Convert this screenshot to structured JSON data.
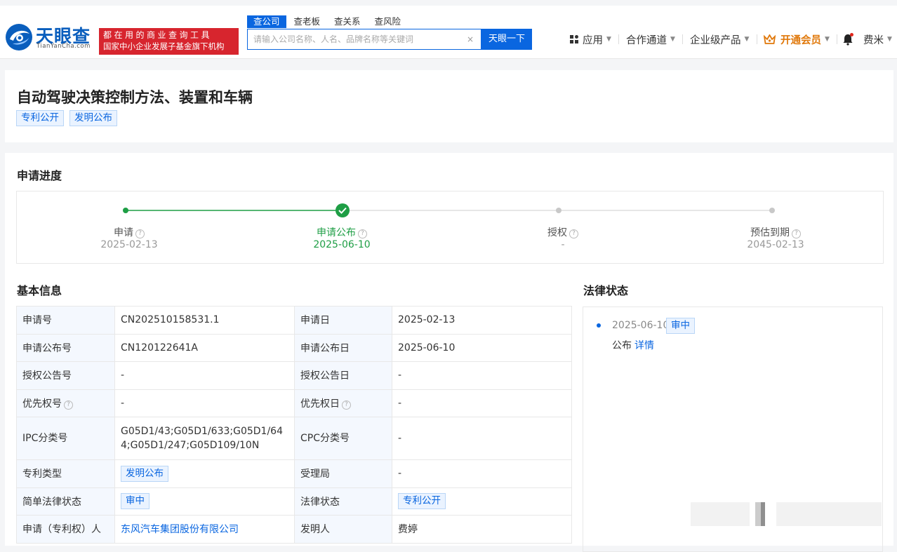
{
  "header": {
    "logo_cn": "天眼查",
    "logo_en": "TianYanCha.com",
    "slogan_line1": "都在用的商业查询工具",
    "slogan_line2": "国家中小企业发展子基金旗下机构",
    "search_tabs": [
      "查公司",
      "查老板",
      "查关系",
      "查风险"
    ],
    "search_placeholder": "请输入公司名称、人名、品牌名称等关键词",
    "search_clear": "×",
    "search_button": "天眼一下",
    "nav": {
      "apps": "应用",
      "partner": "合作通道",
      "enterprise": "企业级产品",
      "vip": "开通会员",
      "user": "费米"
    }
  },
  "patent": {
    "title": "自动驾驶决策控制方法、装置和车辆",
    "tags": [
      "专利公开",
      "发明公布"
    ]
  },
  "progress": {
    "heading": "申请进度",
    "steps": [
      {
        "label": "申请",
        "date": "2025-02-13",
        "state": "done"
      },
      {
        "label": "申请公布",
        "date": "2025-06-10",
        "state": "current"
      },
      {
        "label": "授权",
        "date": "-",
        "state": "pending"
      },
      {
        "label": "预估到期",
        "date": "2045-02-13",
        "state": "pending"
      }
    ]
  },
  "basic": {
    "heading": "基本信息",
    "rows": [
      {
        "k1": "申请号",
        "v1": "CN202510158531.1",
        "k2": "申请日",
        "v2": "2025-02-13"
      },
      {
        "k1": "申请公布号",
        "v1": "CN120122641A",
        "k2": "申请公布日",
        "v2": "2025-06-10"
      },
      {
        "k1": "授权公告号",
        "v1": "-",
        "k2": "授权公告日",
        "v2": "-"
      },
      {
        "k1": "优先权号",
        "v1": "-",
        "k2": "优先权日",
        "v2": "-"
      },
      {
        "k1": "IPC分类号",
        "v1": "G05D1/43;G05D1/633;G05D1/644;G05D1/247;G05D109/10N",
        "k2": "CPC分类号",
        "v2": "-"
      },
      {
        "k1": "专利类型",
        "v1": "发明公布",
        "k2": "受理局",
        "v2": "-"
      },
      {
        "k1": "简单法律状态",
        "v1": "审中",
        "k2": "法律状态",
        "v2": "专利公开"
      },
      {
        "k1": "申请（专利权）人",
        "v1": "东风汽车集团股份有限公司",
        "k2": "发明人",
        "v2": "费婷"
      }
    ]
  },
  "legal": {
    "heading": "法律状态",
    "date": "2025-06-10",
    "tag": "审中",
    "desc": "公布",
    "link": "详情"
  },
  "colors": {
    "brand": "#0a66e0",
    "slogan": "#d7252e",
    "progress": "#1e9e45",
    "vip": "#e0780a"
  }
}
